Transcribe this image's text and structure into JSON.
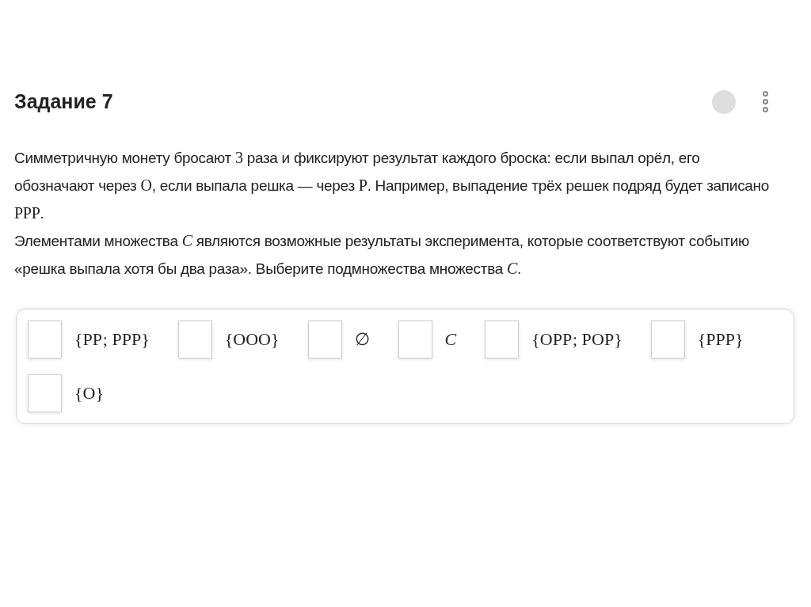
{
  "task": {
    "title": "Задание 7"
  },
  "paragraphs": [
    [
      {
        "kind": "text",
        "text": "Симметричную монету бросают "
      },
      {
        "kind": "math",
        "text": "3"
      },
      {
        "kind": "text",
        "text": " раза и фиксируют результат каждого броска: если выпал орёл, его обозначают через "
      },
      {
        "kind": "math",
        "text": "О"
      },
      {
        "kind": "text",
        "text": ", если выпала решка — через "
      },
      {
        "kind": "math",
        "text": "Р"
      },
      {
        "kind": "text",
        "text": ". Например, выпадение трёх решек подряд будет записано "
      },
      {
        "kind": "math",
        "text": "РРР"
      },
      {
        "kind": "text",
        "text": "."
      }
    ],
    [
      {
        "kind": "text",
        "text": "Элементами множества "
      },
      {
        "kind": "math",
        "text": "*C*"
      },
      {
        "kind": "text",
        "text": " являются возможные результаты эксперимента, которые соответствуют событию «решка выпала хотя бы два раза». Выберите подмножества множества "
      },
      {
        "kind": "math",
        "text": "*C*"
      },
      {
        "kind": "text",
        "text": "."
      }
    ]
  ],
  "options": [
    {
      "label": "{РР; РРР}",
      "checked": false
    },
    {
      "label": "{ООО}",
      "checked": false
    },
    {
      "label": "∅",
      "checked": false
    },
    {
      "label": "*C*",
      "checked": false
    },
    {
      "label": "{ОРР; РОР}",
      "checked": false
    },
    {
      "label": "{РРР}",
      "checked": false
    },
    {
      "label": "{О}",
      "checked": false
    }
  ]
}
